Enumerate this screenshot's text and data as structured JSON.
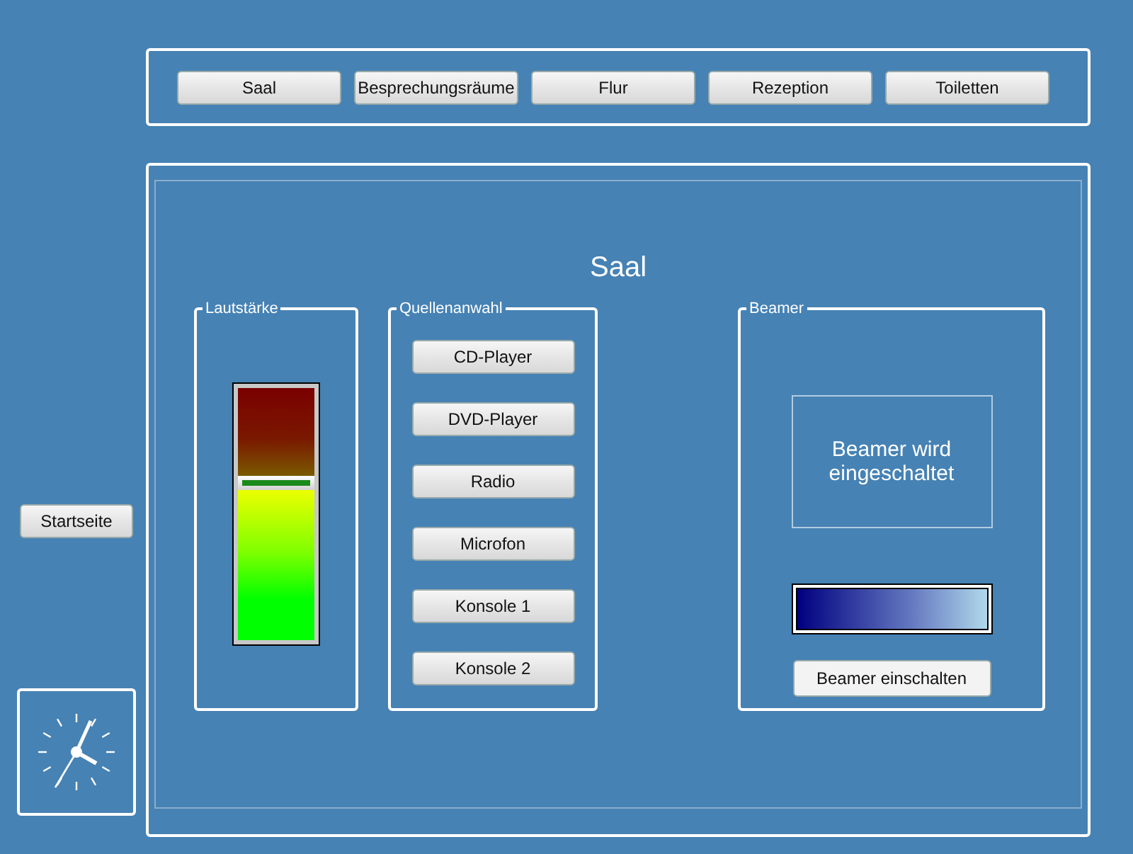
{
  "nav": [
    {
      "label": "Saal"
    },
    {
      "label": "Besprechungsräume"
    },
    {
      "label": "Flur"
    },
    {
      "label": "Rezeption"
    },
    {
      "label": "Toiletten"
    }
  ],
  "home_button": "Startseite",
  "title": "Saal",
  "volume": {
    "legend": "Lautstärke",
    "level": 0.64
  },
  "sources": {
    "legend": "Quellenanwahl",
    "buttons": [
      "CD-Player",
      "DVD-Player",
      "Radio",
      "Microfon",
      "Konsole 1",
      "Konsole 2"
    ]
  },
  "beamer": {
    "legend": "Beamer",
    "status": "Beamer wird eingeschaltet",
    "progress": {
      "level": 1
    },
    "button": "Beamer einschalten"
  }
}
